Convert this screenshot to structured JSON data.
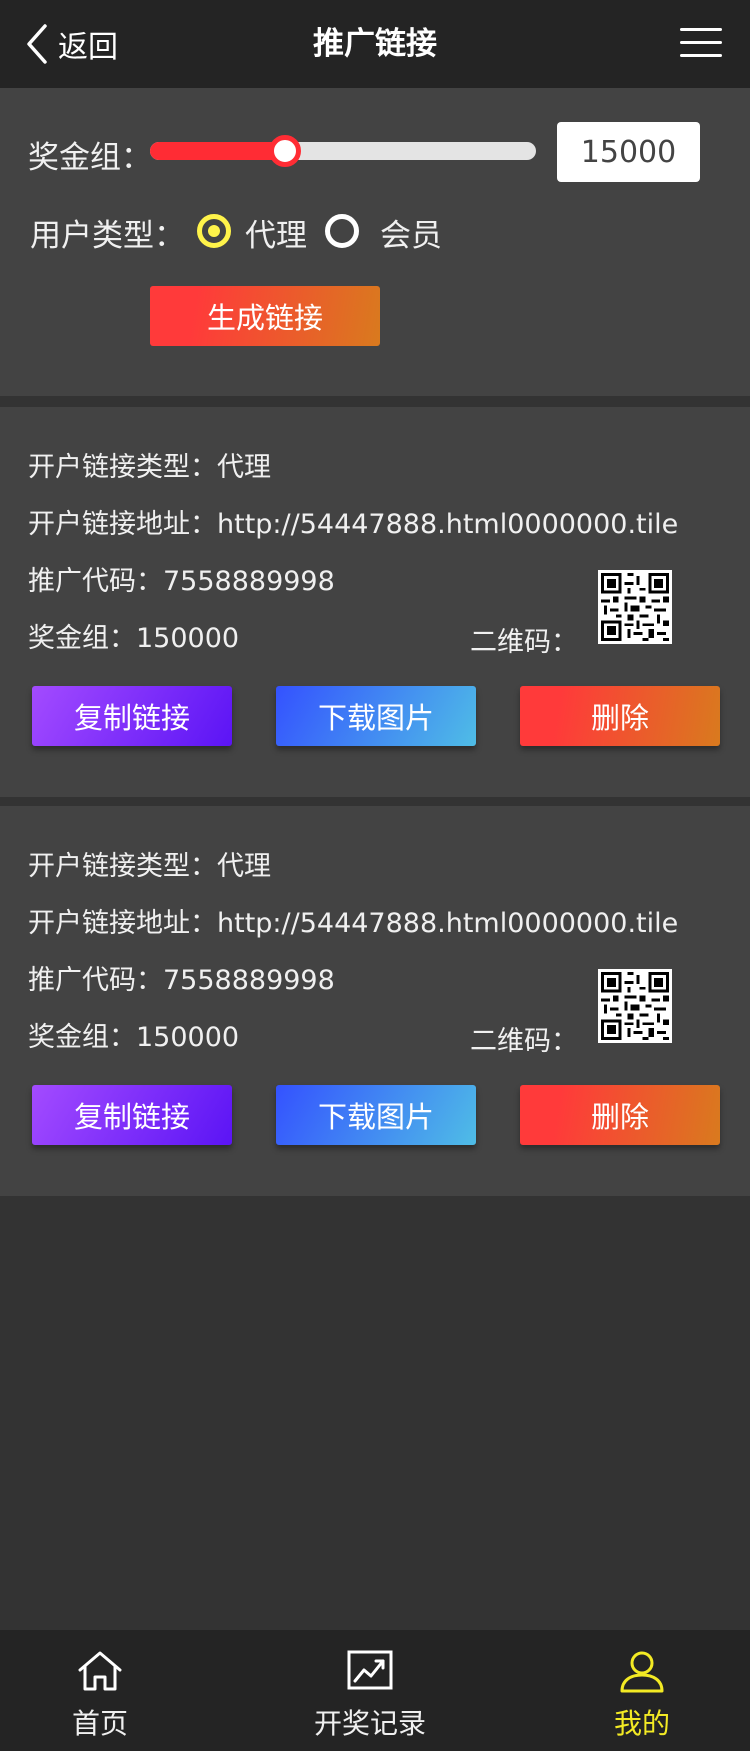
{
  "header": {
    "back_label": "返回",
    "title": "推广链接"
  },
  "form": {
    "bonus_group_label": "奖金组：",
    "bonus_group_value": "15000",
    "slider_fraction": 0.35,
    "user_type_label": "用户类型：",
    "user_type_options": [
      {
        "label": "代理",
        "selected": true
      },
      {
        "label": "会员",
        "selected": false
      }
    ],
    "generate_button": "生成链接"
  },
  "links": [
    {
      "type_line": "开户链接类型：代理",
      "url_line": "开户链接地址：http://54447888.html0000000.tile",
      "code_line": "推广代码：7558889998",
      "bonus_line": "奖金组：150000",
      "qr_label": "二维码：",
      "copy_button": "复制链接",
      "download_button": "下载图片",
      "delete_button": "删除"
    },
    {
      "type_line": "开户链接类型：代理",
      "url_line": "开户链接地址：http://54447888.html0000000.tile",
      "code_line": "推广代码：7558889998",
      "bonus_line": "奖金组：150000",
      "qr_label": "二维码：",
      "copy_button": "复制链接",
      "download_button": "下载图片",
      "delete_button": "删除"
    }
  ],
  "tabbar": {
    "items": [
      {
        "label": "首页",
        "icon": "home-icon",
        "active": false
      },
      {
        "label": "开奖记录",
        "icon": "chart-icon",
        "active": false
      },
      {
        "label": "我的",
        "icon": "user-icon",
        "active": true
      }
    ]
  },
  "colors": {
    "accent_yellow": "#f3ea24",
    "slider_red": "#ff2c34",
    "background": "#333333",
    "panel": "#434343"
  }
}
